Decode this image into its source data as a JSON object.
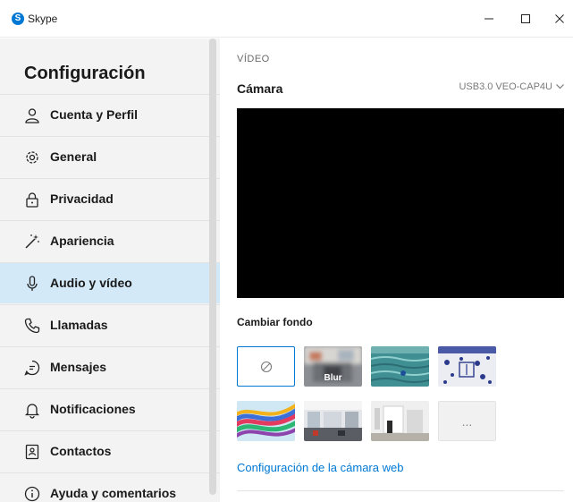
{
  "window": {
    "title": "Skype",
    "logo_letter": "S",
    "minimize_symbol": "—",
    "maximize_symbol": "☐",
    "close_symbol": "✕"
  },
  "sidebar": {
    "heading": "Configuración",
    "items": [
      {
        "label": "Cuenta y Perfil",
        "icon": "person-icon",
        "active": false
      },
      {
        "label": "General",
        "icon": "gear-icon",
        "active": false
      },
      {
        "label": "Privacidad",
        "icon": "lock-icon",
        "active": false
      },
      {
        "label": "Apariencia",
        "icon": "magic-wand-icon",
        "active": false
      },
      {
        "label": "Audio y vídeo",
        "icon": "microphone-icon",
        "active": true
      },
      {
        "label": "Llamadas",
        "icon": "phone-icon",
        "active": false
      },
      {
        "label": "Mensajes",
        "icon": "chat-icon",
        "active": false
      },
      {
        "label": "Notificaciones",
        "icon": "bell-icon",
        "active": false
      },
      {
        "label": "Contactos",
        "icon": "contacts-icon",
        "active": false
      },
      {
        "label": "Ayuda y comentarios",
        "icon": "info-icon",
        "active": false
      }
    ]
  },
  "main": {
    "section": "VÍDEO",
    "camera_label": "Cámara",
    "camera_device": "USB3.0 VEO-CAP4U",
    "background_label": "Cambiar fondo",
    "blur_label": "Blur",
    "more_label": "...",
    "webcam_settings_link": "Configuración de la cámara web"
  },
  "colors": {
    "accent": "#0078d4",
    "sidebar_bg": "#f3f3f3",
    "active_item_bg": "#d3e9f7"
  }
}
